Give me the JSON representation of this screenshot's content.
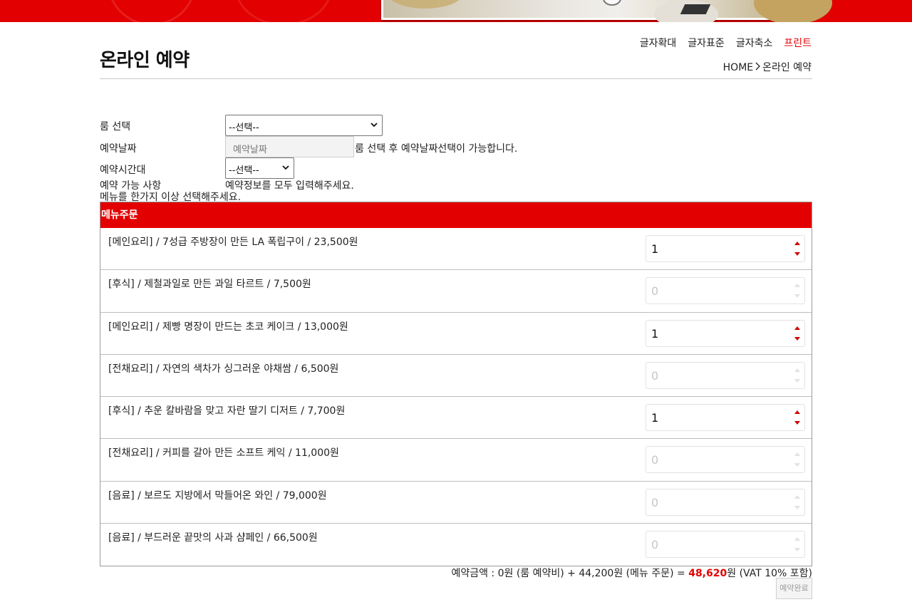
{
  "colors": {
    "accent": "#e30000",
    "text": "#222222",
    "muted": "#9b9b9b"
  },
  "header": {
    "title": "온라인 예약",
    "font_tools": {
      "enlarge": "글자확대",
      "standard": "글자표준",
      "shrink": "글자축소",
      "print": "프린트"
    },
    "breadcrumb": {
      "home": "HOME",
      "separator_icon": "chevron-right-icon",
      "current": "온라인 예약"
    }
  },
  "form": {
    "room": {
      "label": "룸 선택",
      "selected": "--선택--"
    },
    "date": {
      "label": "예약날짜",
      "placeholder": "예약날짜",
      "hint": "룸 선택 후 예약날짜선택이 가능합니다."
    },
    "time": {
      "label": "예약시간대",
      "selected": "--선택--"
    },
    "availability": {
      "label": "예약 가능 사항",
      "message": "예약정보를 모두 입력해주세요."
    },
    "menu_notice": "메뉴를 한가지 이상 선택해주세요."
  },
  "menu": {
    "header": "메뉴주문",
    "items": [
      {
        "label": "[메인요리] / 7성급 주방장이 만든 LA 폭립구이 / 23,500원",
        "qty": "1"
      },
      {
        "label": "[후식] / 제철과일로 만든 과일 타르트 / 7,500원",
        "qty": "0"
      },
      {
        "label": "[메인요리] / 제빵 명장이 만드는 초코 케이크 / 13,000원",
        "qty": "1"
      },
      {
        "label": "[전채요리] / 자연의 색차가 싱그러운 야채쌈 / 6,500원",
        "qty": "0"
      },
      {
        "label": "[후식] / 추운 칼바람을 맞고 자란 딸기 디저트 / 7,700원",
        "qty": "1"
      },
      {
        "label": "[전채요리] / 커피를 갈아 만든 소프트 케익 / 11,000원",
        "qty": "0"
      },
      {
        "label": "[음료] / 보르도 지방에서 막들어온 와인 / 79,000원",
        "qty": "0"
      },
      {
        "label": "[음료] / 부드러운 끝맛의 사과 샴페인 / 66,500원",
        "qty": "0"
      }
    ]
  },
  "summary": {
    "prefix": "예약금액 : 0원 (룸 예약비) + 44,200원 (메뉴 주문) = ",
    "total": "48,620",
    "suffix": "원 (VAT 10% 포함)"
  },
  "submit": {
    "label": "예약완료"
  }
}
